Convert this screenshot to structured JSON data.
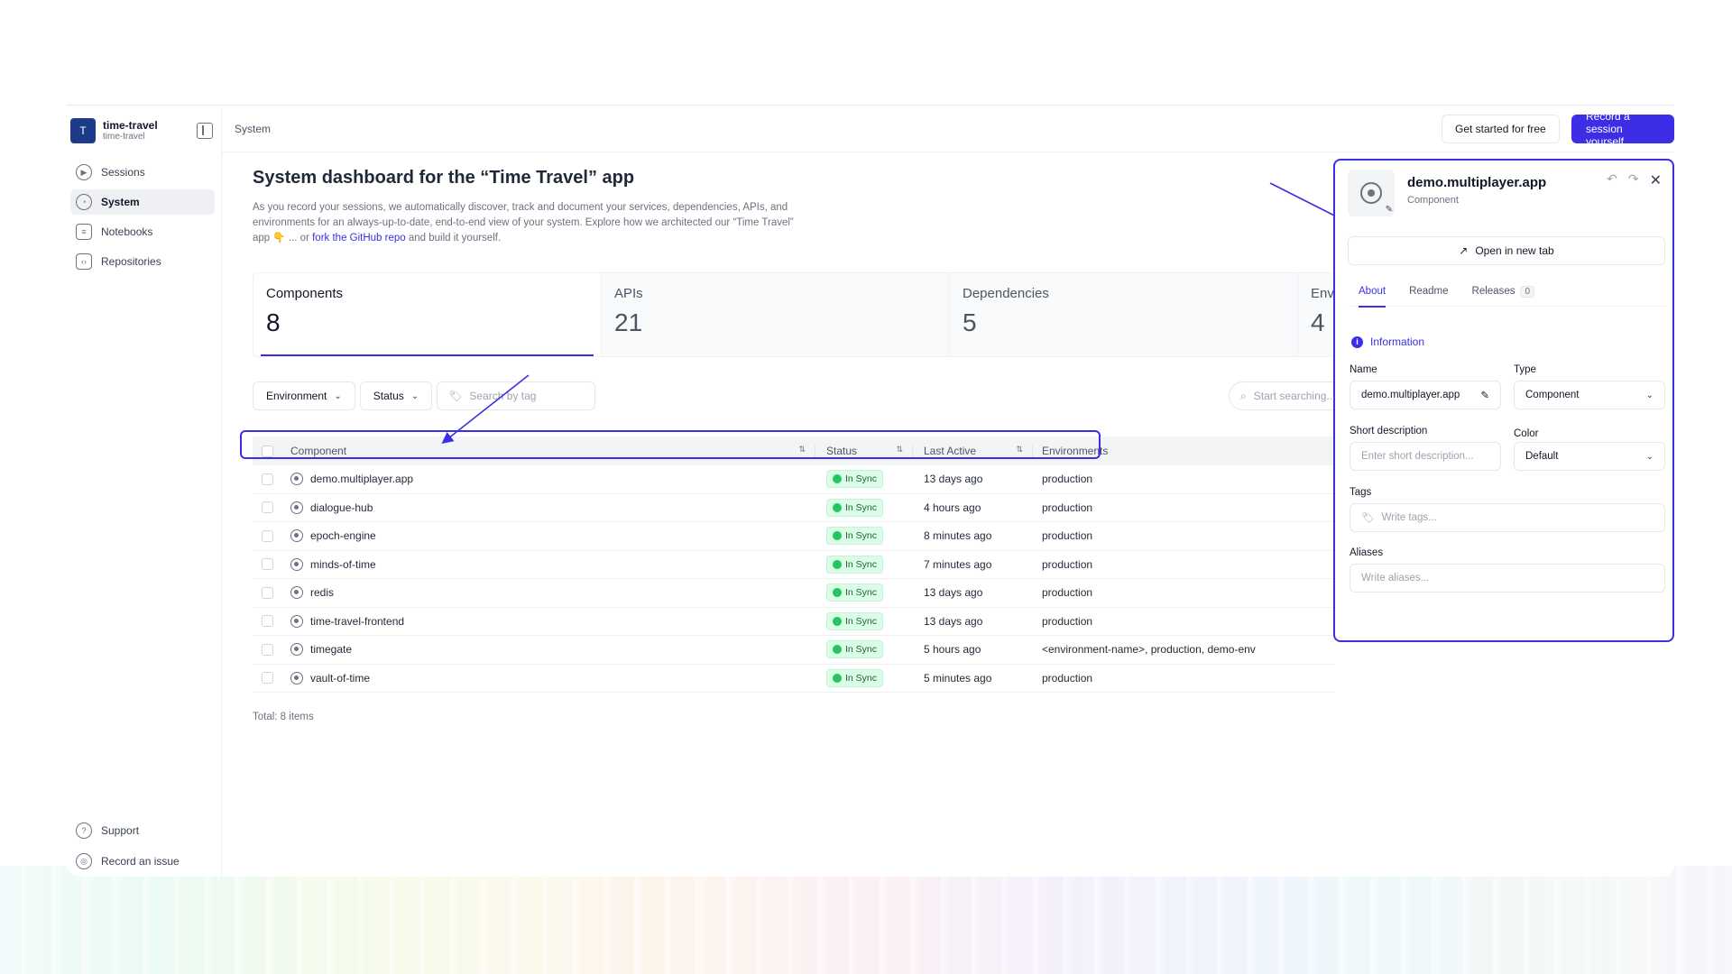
{
  "workspace": {
    "avatar": "T",
    "name": "time-travel",
    "sub": "time-travel"
  },
  "sidebar": {
    "items": [
      {
        "label": "Sessions",
        "icon": "play-icon"
      },
      {
        "label": "System",
        "icon": "system-icon"
      },
      {
        "label": "Notebooks",
        "icon": "notebook-icon"
      },
      {
        "label": "Repositories",
        "icon": "code-icon"
      }
    ],
    "bottom": [
      {
        "label": "Support",
        "icon": "help-icon"
      },
      {
        "label": "Record an issue",
        "icon": "lifebuoy-icon"
      }
    ]
  },
  "header": {
    "breadcrumb": "System",
    "get_started": "Get started for free",
    "record_session": "Record a session yourself"
  },
  "main": {
    "title": "System dashboard for the “Time Travel” app",
    "desc_1": "As you record your sessions, we automatically discover, track and document your services, dependencies, APIs, and environments for an always-up-to-date, end-to-end view of your system. Explore how we architected our “Time Travel” app 👇 ... or ",
    "desc_link": "fork the GitHub repo",
    "desc_2": " and build it yourself.",
    "stats": [
      {
        "label": "Components",
        "value": "8"
      },
      {
        "label": "APIs",
        "value": "21"
      },
      {
        "label": "Dependencies",
        "value": "5"
      },
      {
        "label": "Envi",
        "value": "4"
      }
    ],
    "filters": {
      "environment": "Environment",
      "status": "Status",
      "tag_placeholder": "Search by tag",
      "search_placeholder": "Start searching..."
    },
    "table": {
      "columns": [
        "Component",
        "Status",
        "Last Active",
        "Environments"
      ],
      "rows": [
        {
          "name": "demo.multiplayer.app",
          "status": "In Sync",
          "last": "13 days ago",
          "env": "production"
        },
        {
          "name": "dialogue-hub",
          "status": "In Sync",
          "last": "4 hours ago",
          "env": "production"
        },
        {
          "name": "epoch-engine",
          "status": "In Sync",
          "last": "8 minutes ago",
          "env": "production"
        },
        {
          "name": "minds-of-time",
          "status": "In Sync",
          "last": "7 minutes ago",
          "env": "production"
        },
        {
          "name": "redis",
          "status": "In Sync",
          "last": "13 days ago",
          "env": "production"
        },
        {
          "name": "time-travel-frontend",
          "status": "In Sync",
          "last": "13 days ago",
          "env": "production"
        },
        {
          "name": "timegate",
          "status": "In Sync",
          "last": "5 hours ago",
          "env": "<environment-name>, production, demo-env"
        },
        {
          "name": "vault-of-time",
          "status": "In Sync",
          "last": "5 minutes ago",
          "env": "production"
        }
      ],
      "total": "Total: 8 items"
    }
  },
  "panel": {
    "title": "demo.multiplayer.app",
    "subtitle": "Component",
    "open_tab": "Open in new tab",
    "tabs": {
      "about": "About",
      "readme": "Readme",
      "releases": "Releases",
      "releases_count": "0"
    },
    "info_heading": "Information",
    "name_label": "Name",
    "name_value": "demo.multiplayer.app",
    "type_label": "Type",
    "type_value": "Component",
    "short_desc_label": "Short description",
    "short_desc_placeholder": "Enter short description...",
    "color_label": "Color",
    "color_value": "Default",
    "tags_label": "Tags",
    "tags_placeholder": "Write tags...",
    "aliases_label": "Aliases",
    "aliases_placeholder": "Write aliases..."
  },
  "colors": {
    "accent": "#3b2ee6",
    "sync_bg": "#dcfce7",
    "sync_text": "#166534"
  }
}
